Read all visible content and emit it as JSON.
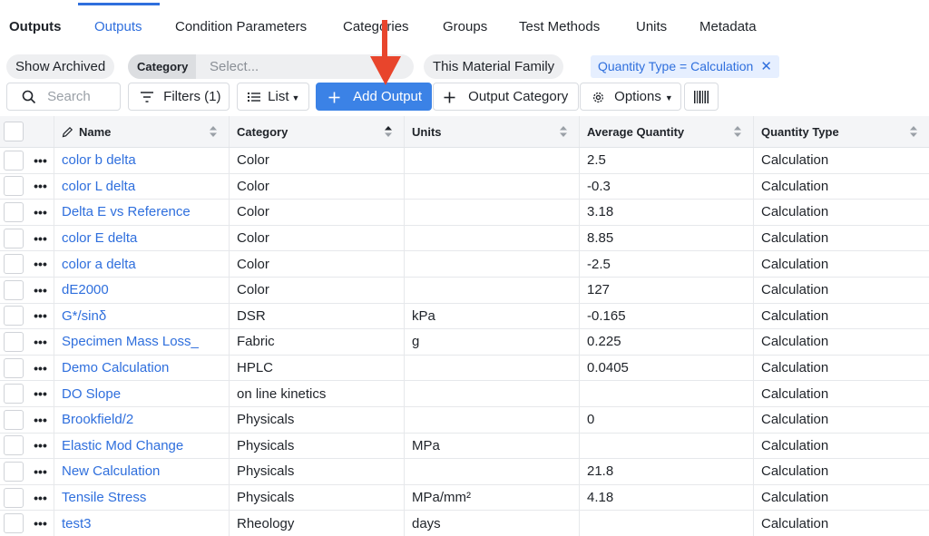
{
  "nav": {
    "title": "Outputs",
    "tabs": [
      "Outputs",
      "Condition Parameters",
      "Categories",
      "Groups",
      "Test Methods",
      "Units",
      "Metadata"
    ]
  },
  "filters": {
    "show_archived": "Show Archived",
    "category_label": "Category",
    "category_placeholder": "Select...",
    "this_material_family": "This Material Family",
    "active_chip": "Quantity Type = Calculation"
  },
  "toolbar": {
    "search_placeholder": "Search",
    "filters": "Filters (1)",
    "list": "List",
    "add_output": "Add Output",
    "output_category": "Output Category",
    "options": "Options"
  },
  "table": {
    "columns": [
      "Name",
      "Category",
      "Units",
      "Average Quantity",
      "Quantity Type"
    ],
    "rows": [
      [
        "color b delta",
        "Color",
        "",
        "2.5",
        "Calculation"
      ],
      [
        "color L delta",
        "Color",
        "",
        "-0.3",
        "Calculation"
      ],
      [
        "Delta E vs Reference",
        "Color",
        "",
        "3.18",
        "Calculation"
      ],
      [
        "color E delta",
        "Color",
        "",
        "8.85",
        "Calculation"
      ],
      [
        "color a delta",
        "Color",
        "",
        "-2.5",
        "Calculation"
      ],
      [
        "dE2000",
        "Color",
        "",
        "127",
        "Calculation"
      ],
      [
        "G*/sinδ",
        "DSR",
        "kPa",
        "-0.165",
        "Calculation"
      ],
      [
        "Specimen Mass Loss_",
        "Fabric",
        "g",
        "0.225",
        "Calculation"
      ],
      [
        "Demo Calculation",
        "HPLC",
        "",
        "0.0405",
        "Calculation"
      ],
      [
        "DO Slope",
        "on line kinetics",
        "",
        "",
        "Calculation"
      ],
      [
        "Brookfield/2",
        "Physicals",
        "",
        "0",
        "Calculation"
      ],
      [
        "Elastic Mod Change",
        "Physicals",
        "MPa",
        "",
        "Calculation"
      ],
      [
        "New Calculation",
        "Physicals",
        "",
        "21.8",
        "Calculation"
      ],
      [
        "Tensile Stress",
        "Physicals",
        "MPa/mm²",
        "4.18",
        "Calculation"
      ],
      [
        "test3",
        "Rheology",
        "days",
        "",
        "Calculation"
      ]
    ]
  },
  "colors": {
    "accent": "#3b82e6",
    "link": "#2f6fdd",
    "annotation_arrow": "#e8452c"
  }
}
